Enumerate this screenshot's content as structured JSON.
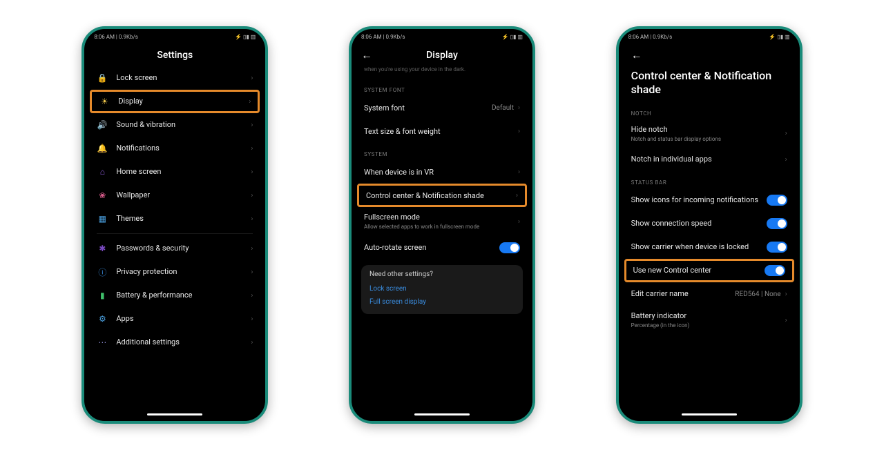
{
  "status": {
    "time": "8:06 AM | 0.9Kb/s",
    "icons": "⚡ ▯▮ ▥"
  },
  "phone1": {
    "title": "Settings",
    "items": [
      {
        "icon": "🔒",
        "color": "#d66b6b",
        "label": "Lock screen"
      },
      {
        "icon": "☀",
        "color": "#f2c94c",
        "label": "Display",
        "highlight": true
      },
      {
        "icon": "🔊",
        "color": "#3fbf6a",
        "label": "Sound & vibration"
      },
      {
        "icon": "🔔",
        "color": "#4a8fe0",
        "label": "Notifications"
      },
      {
        "icon": "⌂",
        "color": "#8a5bd6",
        "label": "Home screen"
      },
      {
        "icon": "❀",
        "color": "#d65b8a",
        "label": "Wallpaper"
      },
      {
        "icon": "▦",
        "color": "#4aa0e0",
        "label": "Themes"
      }
    ],
    "items2": [
      {
        "icon": "✱",
        "color": "#7a4ac0",
        "label": "Passwords & security"
      },
      {
        "icon": "ⓘ",
        "color": "#3a8de0",
        "label": "Privacy protection"
      },
      {
        "icon": "▮",
        "color": "#3fbf6a",
        "label": "Battery & performance"
      },
      {
        "icon": "⚙",
        "color": "#4aa0e0",
        "label": "Apps"
      },
      {
        "icon": "⋯",
        "color": "#8888cc",
        "label": "Additional settings"
      }
    ]
  },
  "phone2": {
    "title": "Display",
    "hint": "when you're using your device in the dark.",
    "sections": [
      {
        "label": "SYSTEM FONT",
        "rows": [
          {
            "label": "System font",
            "value": "Default"
          },
          {
            "label": "Text size & font weight"
          }
        ]
      },
      {
        "label": "SYSTEM",
        "rows": [
          {
            "label": "When device is in VR"
          },
          {
            "label": "Control center & Notification shade",
            "highlight": true
          },
          {
            "label": "Fullscreen mode",
            "sub": "Allow selected apps to work in fullscreen mode"
          },
          {
            "label": "Auto-rotate screen",
            "toggle": true
          }
        ]
      }
    ],
    "card": {
      "title": "Need other settings?",
      "links": [
        "Lock screen",
        "Full screen display"
      ]
    }
  },
  "phone3": {
    "title": "Control center & Notification shade",
    "sections": [
      {
        "label": "NOTCH",
        "rows": [
          {
            "label": "Hide notch",
            "sub": "Notch and status bar display options"
          },
          {
            "label": "Notch in individual apps"
          }
        ]
      },
      {
        "label": "STATUS BAR",
        "rows": [
          {
            "label": "Show icons for incoming notifications",
            "toggle": true
          },
          {
            "label": "Show connection speed",
            "toggle": true
          },
          {
            "label": "Show carrier when device is locked",
            "toggle": true
          },
          {
            "label": "Use new Control center",
            "toggle": true,
            "highlight": true
          },
          {
            "label": "Edit carrier name",
            "value": "RED564 | None"
          },
          {
            "label": "Battery indicator",
            "sub": "Percentage (in the icon)"
          }
        ]
      }
    ]
  }
}
